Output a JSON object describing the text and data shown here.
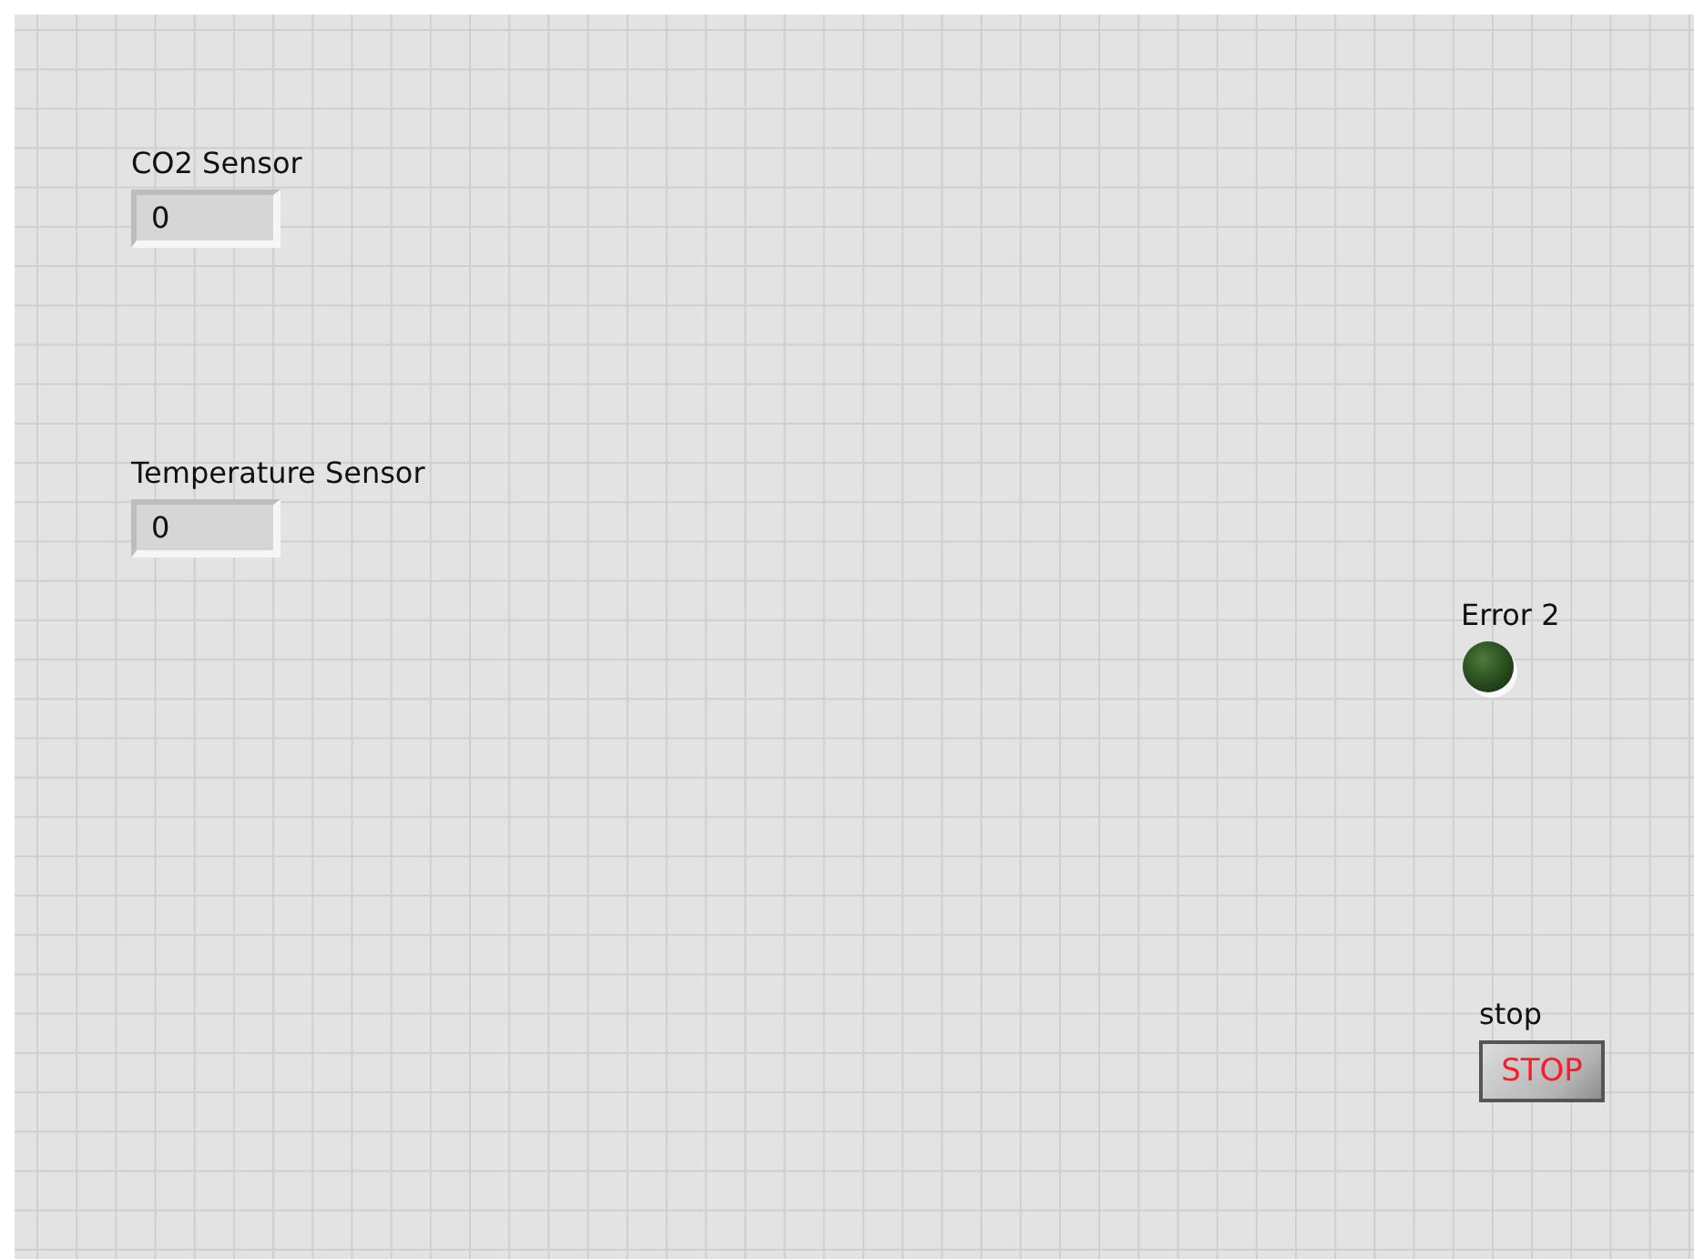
{
  "panel": {
    "controls": [
      {
        "kind": "numeric",
        "label": "CO2 Sensor",
        "value": "0"
      },
      {
        "kind": "numeric",
        "label": "Temperature Sensor",
        "value": "0"
      },
      {
        "kind": "led",
        "label": "Error 2",
        "on": false
      },
      {
        "kind": "button",
        "label": "stop",
        "text": "STOP"
      }
    ]
  }
}
